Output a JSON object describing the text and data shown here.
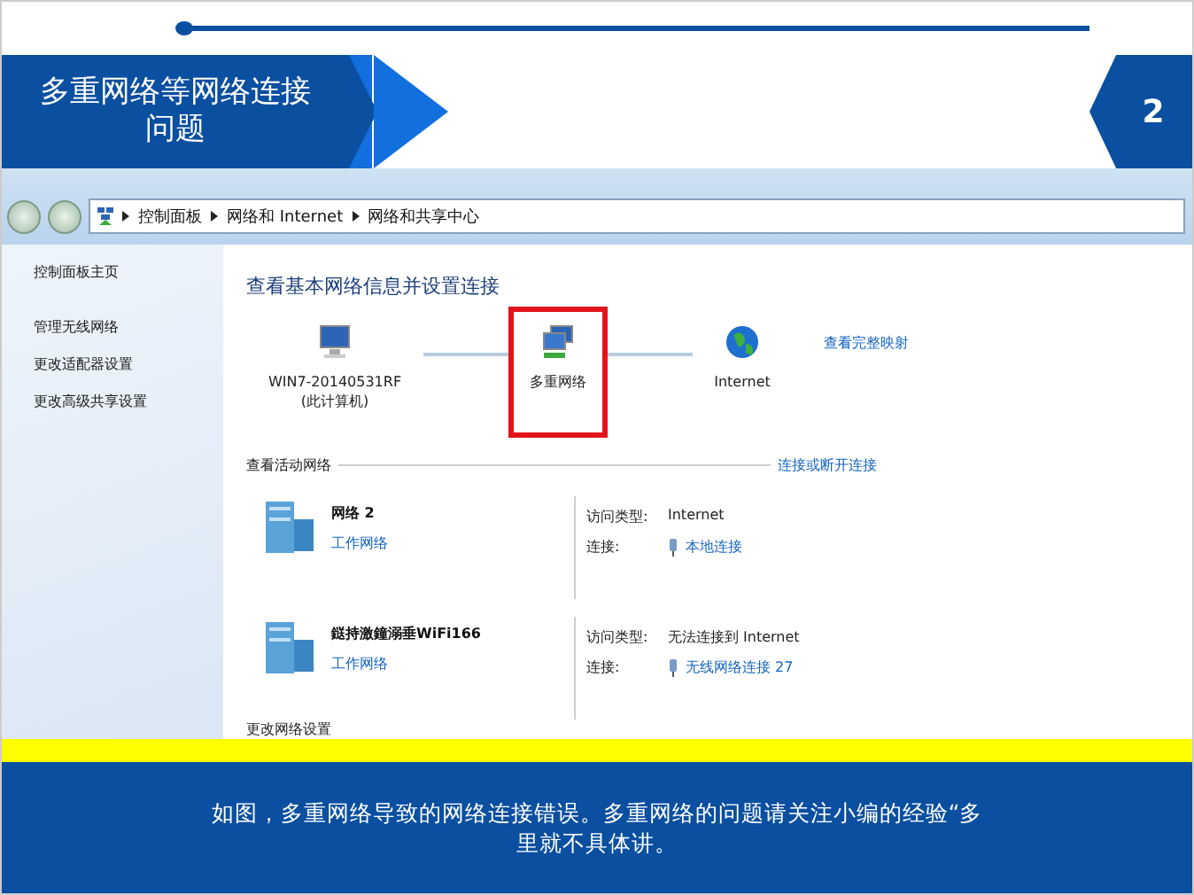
{
  "slide": {
    "title": "多重网络等网络连接问题",
    "page_number": "2"
  },
  "window": {
    "breadcrumb": [
      "控制面板",
      "网络和 Internet",
      "网络和共享中心"
    ]
  },
  "sidebar": {
    "items": [
      {
        "label": "控制面板主页"
      },
      {
        "label": "管理无线网络"
      },
      {
        "label": "更改适配器设置"
      },
      {
        "label": "更改高级共享设置"
      }
    ]
  },
  "main": {
    "heading": "查看基本网络信息并设置连接",
    "map_link": "查看完整映射",
    "map_nodes": [
      {
        "kind": "computer",
        "label": "WIN7-20140531RF",
        "sublabel": "(此计算机)",
        "highlighted": false
      },
      {
        "kind": "multi",
        "label": "多重网络",
        "highlighted": true
      },
      {
        "kind": "globe",
        "label": "Internet",
        "highlighted": false
      }
    ],
    "active_heading": "查看活动网络",
    "connect_link": "连接或断开连接",
    "networks": [
      {
        "name": "网络  2",
        "type": "工作网络",
        "access_label": "访问类型:",
        "access": "Internet",
        "conn_label": "连接:",
        "connection": "本地连接"
      },
      {
        "name": "鎹持激鐘溺垂WiFi166",
        "type": "工作网络",
        "access_label": "访问类型:",
        "access": "无法连接到 Internet",
        "conn_label": "连接:",
        "connection": "无线网络连接 27"
      }
    ],
    "settings_heading": "更改网络设置"
  },
  "caption": [
    "如图，多重网络导致的网络连接错误。多重网络的问题请关注小编的经验“多",
    "里就不具体讲。"
  ]
}
